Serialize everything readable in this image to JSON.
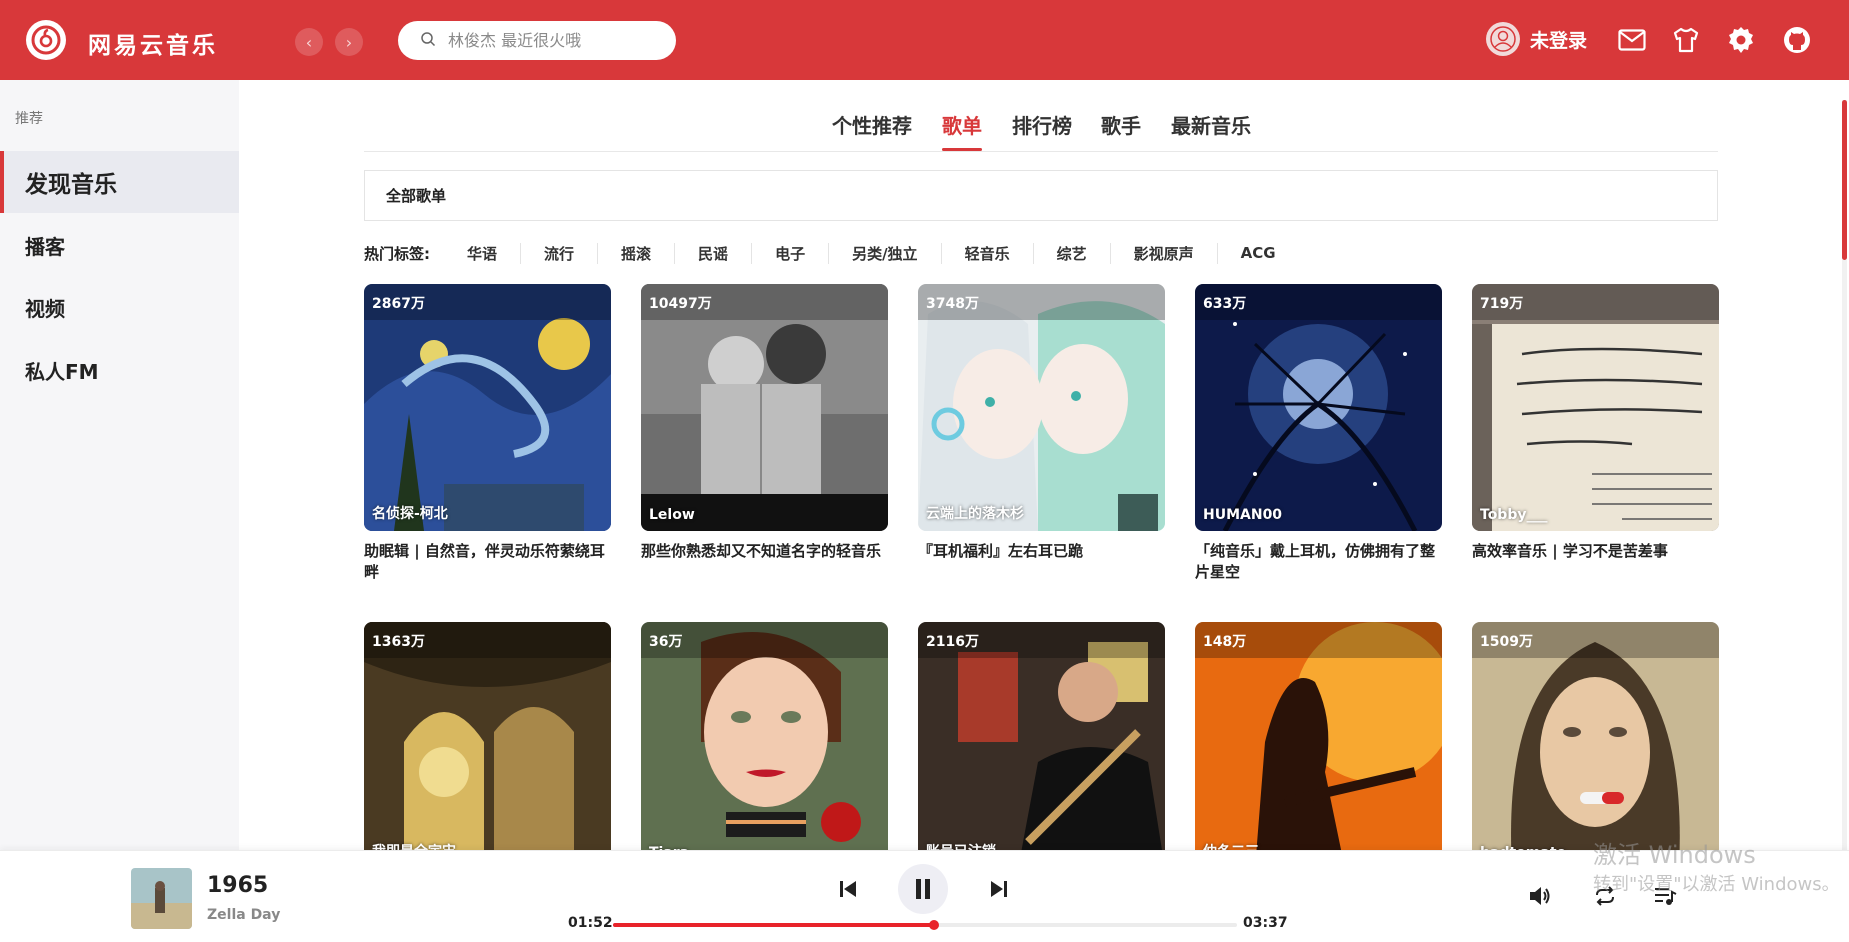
{
  "app": {
    "title": "网易云音乐"
  },
  "header": {
    "search_placeholder": "林俊杰 最近很火哦",
    "user_label": "未登录",
    "back_arrow": "‹",
    "forward_arrow": "›"
  },
  "sidebar": {
    "section_title": "推荐",
    "items": [
      {
        "label": "发现音乐",
        "active": true
      },
      {
        "label": "播客"
      },
      {
        "label": "视频"
      },
      {
        "label": "私人FM"
      }
    ]
  },
  "tabs": [
    "个性推荐",
    "歌单",
    "排行榜",
    "歌手",
    "最新音乐"
  ],
  "active_tab": "歌单",
  "all_playlists_label": "全部歌单",
  "hot_tags": {
    "label": "热门标签:",
    "tags": [
      "华语",
      "流行",
      "摇滚",
      "民谣",
      "电子",
      "另类/独立",
      "轻音乐",
      "综艺",
      "影视原声",
      "ACG"
    ]
  },
  "playlists": [
    {
      "count": "2867万",
      "creator": "名侦探-柯北",
      "title": "助眠辑 | 自然音，伴灵动乐符萦绕耳畔"
    },
    {
      "count": "10497万",
      "creator": "Lelow",
      "title": "那些你熟悉却又不知道名字的轻音乐"
    },
    {
      "count": "3748万",
      "creator": "云端上的落木杉",
      "title": "『耳机福利』左右耳已跪"
    },
    {
      "count": "633万",
      "creator": "HUMAN00",
      "title": "「纯音乐」戴上耳机，仿佛拥有了整片星空"
    },
    {
      "count": "719万",
      "creator": "Tobby___",
      "title": "高效率音乐 | 学习不是苦差事"
    },
    {
      "count": "1363万",
      "creator": "我即是全宇宙",
      "title": ""
    },
    {
      "count": "36万",
      "creator": "Tiara",
      "title": ""
    },
    {
      "count": "2116万",
      "creator": "账号已注销",
      "title": ""
    },
    {
      "count": "148万",
      "creator": "仲冬二三",
      "title": ""
    },
    {
      "count": "1509万",
      "creator": "badtomato",
      "title": ""
    }
  ],
  "player": {
    "song": "1965",
    "artist": "Zella Day",
    "current_time": "01:52",
    "total_time": "03:37",
    "progress": 0.515
  },
  "watermark": {
    "line1": "激活 Windows",
    "line2": "转到\"设置\"以激活 Windows。"
  },
  "colors": {
    "brand": "#d8383a",
    "progress": "#e8232a"
  },
  "icons": [
    "logo-icon",
    "search-icon",
    "avatar-icon",
    "mail-icon",
    "shirt-icon",
    "gear-icon",
    "github-icon",
    "prev-icon",
    "pause-icon",
    "next-icon",
    "volume-icon",
    "loop-icon",
    "playlist-icon"
  ]
}
